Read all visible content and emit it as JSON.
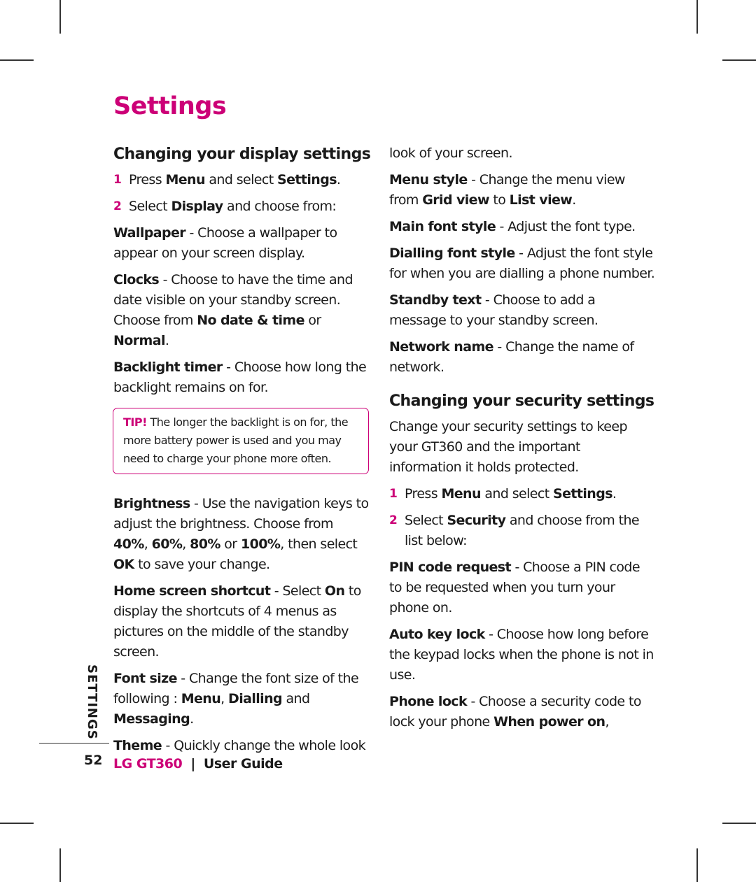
{
  "page": {
    "title": "Settings",
    "side_label": "SETTINGS",
    "page_number": "52",
    "footer": {
      "brand": "LG GT360",
      "separator": "|",
      "guide": "User Guide"
    },
    "colors": {
      "accent": "#cc0077",
      "text": "#1a1a1a"
    }
  },
  "display_section": {
    "heading": "Changing your display settings",
    "steps": [
      {
        "num": "1",
        "pre": "Press ",
        "b1": "Menu",
        "mid": " and select ",
        "b2": "Settings",
        "post": "."
      },
      {
        "num": "2",
        "pre": "Select ",
        "b1": "Display",
        "mid": " and choose from:"
      }
    ],
    "items": {
      "wallpaper": {
        "term": "Wallpaper",
        "desc": " - Choose a wallpaper to appear on your screen display."
      },
      "clocks": {
        "term": "Clocks",
        "desc": " - Choose to have the time and date visible on your standby screen. Choose from ",
        "opt1": "No date & time",
        "or": " or ",
        "opt2": "Normal",
        "end": "."
      },
      "backlight": {
        "term": "Backlight timer",
        "desc": " - Choose how long the backlight remains on for."
      },
      "brightness": {
        "term": "Brightness",
        "desc": " - Use the navigation keys to adjust the brightness. Choose from ",
        "o1": "40%",
        "c1": ", ",
        "o2": "60%",
        "c2": ", ",
        "o3": "80%",
        "c3": " or ",
        "o4": "100%",
        "after": ", then select ",
        "ok": "OK",
        "end": " to save your change."
      },
      "home_shortcut": {
        "term": "Home screen shortcut",
        "desc": " - Select ",
        "on": "On",
        "end": " to display the shortcuts of 4 menus as pictures on the middle of the standby screen."
      },
      "font_size": {
        "term": "Font size",
        "desc": " - Change the font size of the following : ",
        "o1": "Menu",
        "c1": ", ",
        "o2": "Dialling",
        "c2": " and ",
        "o3": "Messaging",
        "end": "."
      },
      "theme": {
        "term": "Theme",
        "desc": " - Quickly change the whole look of your screen."
      },
      "menu_style": {
        "term": "Menu style",
        "desc": " - Change the menu view from  ",
        "o1": "Grid view",
        "mid": " to ",
        "o2": "List view",
        "end": "."
      },
      "main_font": {
        "term": "Main font style",
        "desc": " - Adjust the font type."
      },
      "dialling_font": {
        "term": "Dialling font style",
        "desc": " - Adjust the font style for when you are dialling a phone number."
      },
      "standby_text": {
        "term": "Standby text",
        "desc": " - Choose to add a message to your standby screen."
      },
      "network_name": {
        "term": "Network name",
        "desc": " - Change the name of network."
      }
    },
    "tip": {
      "label": "TIP!",
      "text": " The longer the backlight is on for, the more battery power is used and you may need to charge your phone more often."
    }
  },
  "security_section": {
    "heading": "Changing your security settings",
    "intro": "Change your security settings to keep your GT360 and the important information it holds protected.",
    "steps": [
      {
        "num": "1",
        "pre": "Press ",
        "b1": "Menu",
        "mid": " and select ",
        "b2": "Settings",
        "post": "."
      },
      {
        "num": "2",
        "pre": "Select ",
        "b1": "Security",
        "mid": " and choose from the list below:"
      }
    ],
    "items": {
      "pin": {
        "term": "PIN code request",
        "desc": " - Choose a PIN code to be requested when you turn your phone on."
      },
      "auto_key": {
        "term": "Auto key lock",
        "desc": " - Choose how long before the keypad locks when the phone is not in use."
      },
      "phone_lock": {
        "term": "Phone lock",
        "desc": " - Choose a security code to lock your phone ",
        "opt": "When power on",
        "end": ","
      }
    }
  }
}
